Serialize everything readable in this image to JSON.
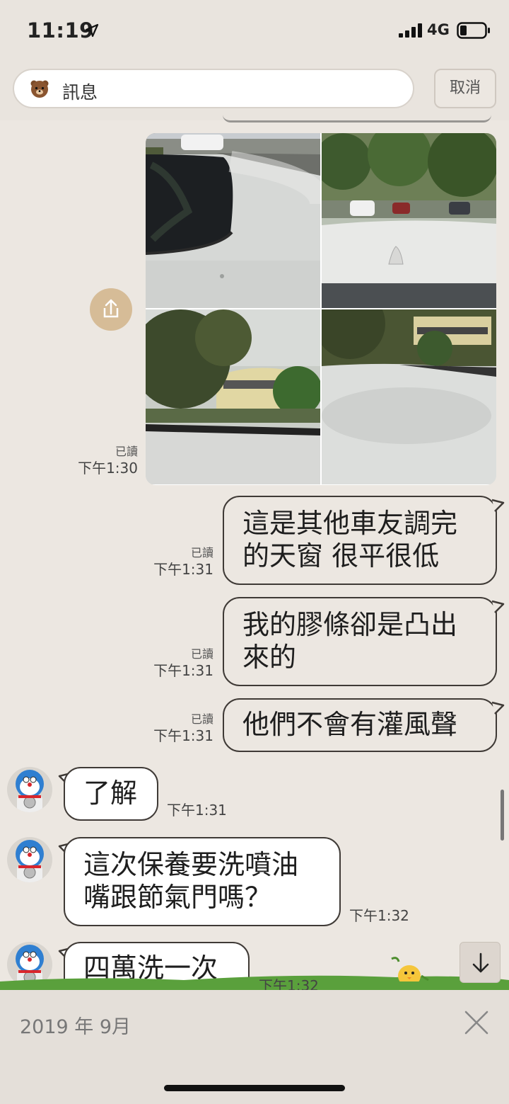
{
  "status_bar": {
    "time": "11:19",
    "network": "4G"
  },
  "search": {
    "placeholder": "訊息",
    "cancel_label": "取消"
  },
  "photo_message": {
    "read_label": "已讀",
    "time": "下午1:30",
    "photo_count": 4
  },
  "messages": [
    {
      "direction": "out",
      "lines": [
        "這是其他車友調完",
        "的天窗 很平很低"
      ],
      "read_label": "已讀",
      "time": "下午1:31"
    },
    {
      "direction": "out",
      "lines": [
        "我的膠條卻是凸出",
        "來的"
      ],
      "read_label": "已讀",
      "time": "下午1:31"
    },
    {
      "direction": "out",
      "lines": [
        "他們不會有灌風聲"
      ],
      "read_label": "已讀",
      "time": "下午1:31"
    },
    {
      "direction": "in",
      "lines": [
        "了解"
      ],
      "time": "下午1:31"
    },
    {
      "direction": "in",
      "lines": [
        "這次保養要洗噴油",
        "嘴跟節氣門嗎？"
      ],
      "time": "下午1:32"
    },
    {
      "direction": "in",
      "lines": [
        "四萬洗一次"
      ],
      "time": "下午1:32"
    }
  ],
  "bottom_bar": {
    "date_label": "2019 年 9月"
  },
  "icons": {
    "share": "share-icon",
    "scroll_down": "arrow-down-icon",
    "close": "close-icon",
    "avatar": "doraemon-avatar"
  },
  "colors": {
    "background": "#ece7e1",
    "bubble_border": "#3f3a36",
    "share_button": "#d6bc97",
    "grass": "#5aa03c"
  }
}
